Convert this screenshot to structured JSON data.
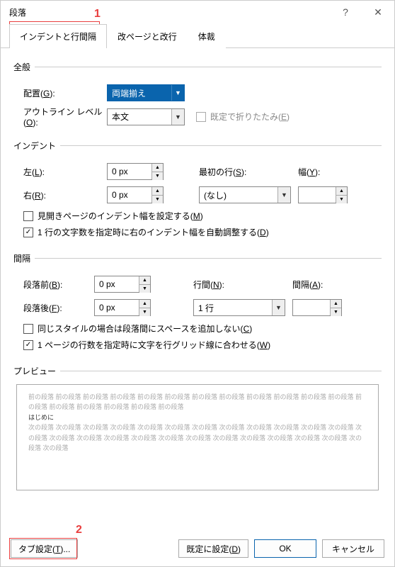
{
  "title": "段落",
  "help_glyph": "?",
  "close_glyph": "✕",
  "annot": {
    "n1": "1",
    "n2": "2"
  },
  "tabs": {
    "t1": "インデントと行間隔",
    "t2": "改ページと改行",
    "t3": "体裁"
  },
  "general": {
    "legend": "全般",
    "align_label": "配置(G):",
    "align_value": "両端揃え",
    "outline_label": "アウトライン レベル(O):",
    "outline_value": "本文",
    "collapse_label": "既定で折りたたみ(E)"
  },
  "indent": {
    "legend": "インデント",
    "left_label": "左(L):",
    "left_value": "0 px",
    "right_label": "右(R):",
    "right_value": "0 px",
    "firstline_label": "最初の行(S):",
    "firstline_value": "(なし)",
    "width_label": "幅(Y):",
    "width_value": "",
    "mirror_label": "見開きページのインデント幅を設定する(M)",
    "auto_label": "1 行の文字数を指定時に右のインデント幅を自動調整する(D)"
  },
  "spacing": {
    "legend": "間隔",
    "before_label": "段落前(B):",
    "before_value": "0 px",
    "after_label": "段落後(F):",
    "after_value": "0 px",
    "linesp_label": "行間(N):",
    "linesp_value": "1 行",
    "at_label": "間隔(A):",
    "at_value": "",
    "nospace_label": "同じスタイルの場合は段落間にスペースを追加しない(C)",
    "snap_label": "1 ページの行数を指定時に文字を行グリッド線に合わせる(W)"
  },
  "preview": {
    "legend": "プレビュー",
    "prev_para": "前の段落 前の段落 前の段落 前の段落 前の段落 前の段落 前の段落 前の段落 前の段落 前の段落 前の段落 前の段落 前の段落 前の段落 前の段落 前の段落 前の段落 前の段落",
    "cur_para": "はじめに",
    "next_para": "次の段落 次の段落 次の段落 次の段落 次の段落 次の段落 次の段落 次の段落 次の段落 次の段落 次の段落 次の段落 次の段落 次の段落 次の段落 次の段落 次の段落 次の段落 次の段落 次の段落 次の段落 次の段落 次の段落 次の段落 次の段落 次の段落"
  },
  "footer": {
    "tabs": "タブ設定(T)...",
    "default": "既定に設定(D)",
    "ok": "OK",
    "cancel": "キャンセル"
  }
}
